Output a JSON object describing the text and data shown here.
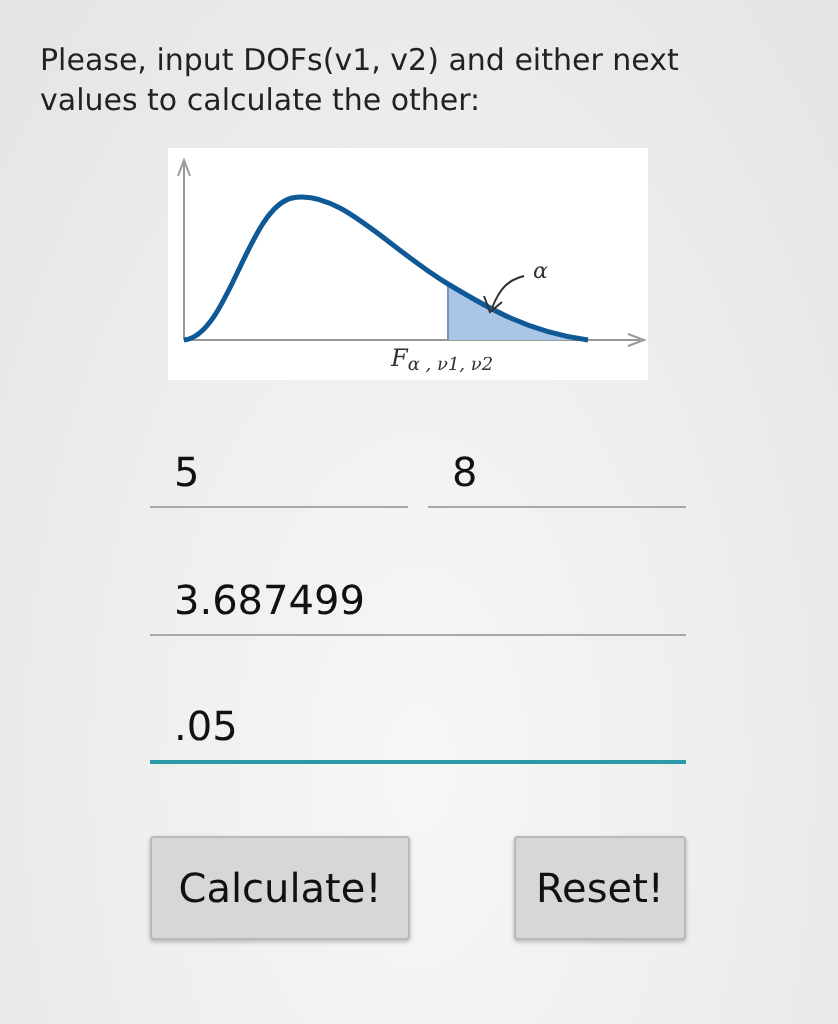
{
  "prompt": "Please, input DOFs(v1, v2) and either next values to calculate the other:",
  "figure": {
    "alpha_label": "α",
    "axis_label": "F$_{α , ν1, ν2}$"
  },
  "fields": [
    {
      "kind": "pair",
      "items": [
        {
          "value": "5",
          "focused": false
        },
        {
          "value": "8",
          "focused": false
        }
      ]
    },
    {
      "kind": "single",
      "items": [
        {
          "value": "3.687499",
          "focused": false
        }
      ]
    },
    {
      "kind": "single",
      "items": [
        {
          "value": ".05",
          "focused": true
        }
      ]
    }
  ],
  "buttons": [
    "Calculate!",
    "Reset!"
  ]
}
